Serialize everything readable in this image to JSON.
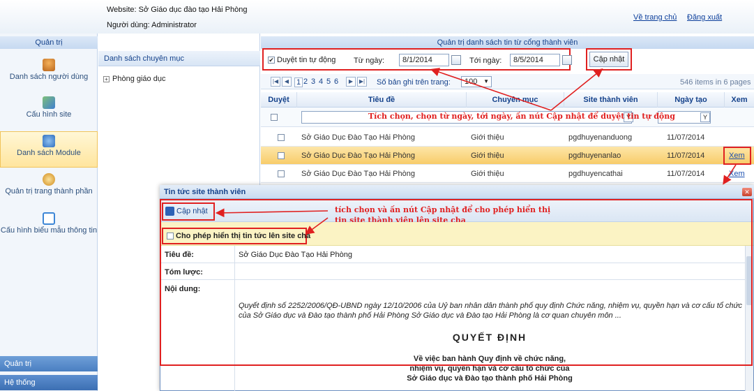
{
  "header": {
    "website": "Website: Sở Giáo dục đào tạo Hải Phòng",
    "user": "Người dùng: Administrator",
    "home_link": "Về trang chủ",
    "logout_link": "Đăng xuất"
  },
  "sidebar": {
    "title": "Quản trị",
    "items": [
      {
        "label": "Danh sách người dùng",
        "icon": "users-icon",
        "color": "#d9822b"
      },
      {
        "label": "Cấu hình site",
        "icon": "site-config-icon",
        "color": "#4a8fd4"
      },
      {
        "label": "Danh sách Module",
        "icon": "module-icon",
        "color": "#5a9ad8"
      },
      {
        "label": "Quản trị trang thành phần",
        "icon": "disk-icon",
        "color": "#e0a030"
      },
      {
        "label": "Cấu hình biểu mẫu thông tin",
        "icon": "form-icon",
        "color": "#3d86d6"
      }
    ],
    "bottom_items": [
      "Quản trị",
      "Hệ thống"
    ]
  },
  "category_panel": {
    "title": "Danh sách chuyên mục",
    "tree_node": "Phòng giáo dục"
  },
  "main": {
    "title": "Quản trị danh sách tin từ cổng thành viên",
    "auto_approve_label": "Duyệt tin tự động",
    "from_label": "Từ ngày:",
    "from_value": "8/1/2014",
    "to_label": "Tới ngày:",
    "to_value": "8/5/2014",
    "update_button": "Cập nhật",
    "pager": {
      "pages": [
        "1",
        "2",
        "3",
        "4",
        "5",
        "6"
      ],
      "page_size_label": "Số bản ghi trên trang:",
      "page_size": "100",
      "summary": "546 items in 6 pages"
    },
    "columns": [
      "Duyệt",
      "Tiêu đề",
      "Chuyên mục",
      "Site thành viên",
      "Ngày tạo",
      "Xem"
    ],
    "rows": [
      {
        "title": "Sở Giáo Dục Đào Tạo Hải Phòng",
        "category": "Giới thiệu",
        "site": "pgdhuyenanduong",
        "date": "11/07/2014",
        "view": "Xem"
      },
      {
        "title": "Sở Giáo Dục Đào Tạo Hải Phòng",
        "category": "Giới thiệu",
        "site": "pgdhuyenanlao",
        "date": "11/07/2014",
        "view": "Xem"
      },
      {
        "title": "Sở Giáo Dục Đào Tạo Hải Phòng",
        "category": "Giới thiệu",
        "site": "pgdhuyencathai",
        "date": "11/07/2014",
        "view": "Xem"
      }
    ],
    "annotation": "Tích chọn, chọn từ ngày, tới ngày, ấn nút Cập nhật để duyệt tin tự động"
  },
  "popup": {
    "title": "Tin tức site thành viên",
    "update_button": "Cập nhật",
    "allow_label": "Cho phép hiển thị tin tức lên site cha",
    "annotation_line1": "tích chọn và ấn nút Cập nhật để cho phép hiển thị",
    "annotation_line2": "tin site thành viên lên site cha",
    "fields": {
      "title_label": "Tiêu đề:",
      "title_value": "Sở Giáo Dục Đào Tạo Hải Phòng",
      "summary_label": "Tóm lược:",
      "content_label": "Nội dung:"
    },
    "content": {
      "paragraph": "Quyết định số 2252/2006/QĐ-UBND ngày 12/10/2006 của Uỷ ban nhân dân thành phố quy định Chức năng, nhiệm vụ, quyền hạn và cơ cấu tổ chức của Sở Giáo dục và Đào tạo thành phố Hải Phòng Sở Giáo dục và Đào tạo Hải Phòng là cơ quan chuyên môn ...",
      "heading": "QUYẾT ĐỊNH",
      "line1": "Về việc ban hành Quy định về chức năng,",
      "line2": "nhiệm vụ, quyền hạn và cơ cấu tổ chức của",
      "line3": "Sở Giáo dục và Đào tạo thành phố Hải Phòng"
    }
  },
  "colors": {
    "annotation_red": "#e02020",
    "selected_row": "#f8cc6a",
    "header_blue": "#15428b"
  }
}
